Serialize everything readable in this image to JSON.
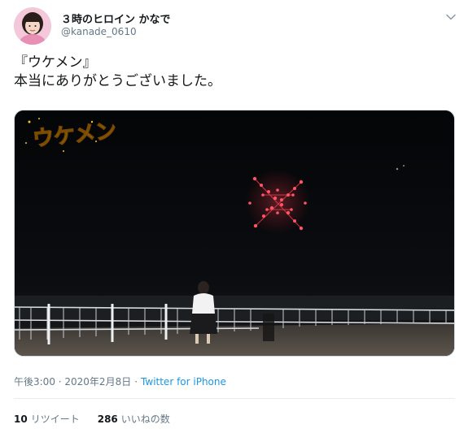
{
  "tweet": {
    "author": {
      "display_name": "３時のヒロイン かなで",
      "handle": "@kanade_0610"
    },
    "text_lines": [
      "『ウケメン』",
      "本当にありがとうございました。"
    ],
    "media": {
      "caption_overlay": "ウケメン"
    },
    "meta": {
      "timestamp": "午後3:00 · 2020年2月8日",
      "separator": "·",
      "source": "Twitter for iPhone"
    },
    "stats": {
      "retweets_count": "10",
      "retweets_label": "リツイート",
      "likes_count": "286",
      "likes_label": "いいねの数"
    }
  },
  "icons": {
    "caret": "chevron-down-icon"
  },
  "colors": {
    "link": "#1b95e0",
    "muted": "#657786",
    "text": "#14171a",
    "drone_lights": "#ff3b4e"
  }
}
